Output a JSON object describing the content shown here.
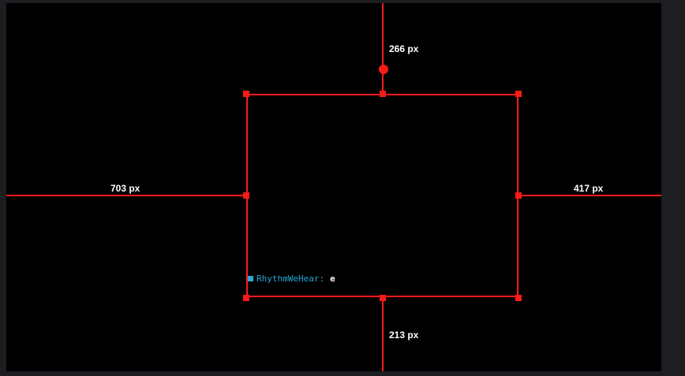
{
  "colors": {
    "accent": "#ff1a1a",
    "background": "#000000",
    "frame": "#1c1e22",
    "username": "#2aa7d6",
    "message": "#ffffff"
  },
  "measurements": {
    "top": "266 px",
    "left": "703 px",
    "right": "417 px",
    "bottom": "213 px"
  },
  "chat": {
    "icon": "chat-badge-icon",
    "username": "RhythmWeHear:",
    "message": "e"
  }
}
